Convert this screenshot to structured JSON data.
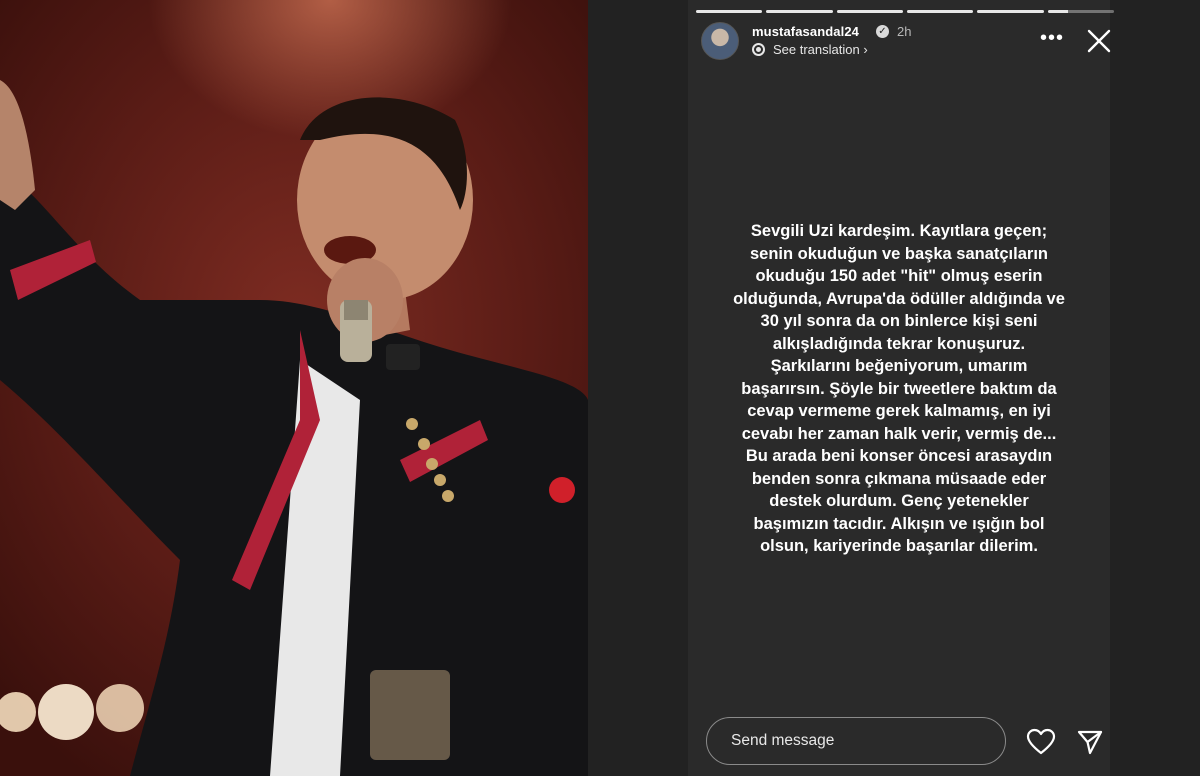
{
  "story": {
    "username": "mustafasandal24",
    "verified_badge": "verified-icon",
    "time_ago": "2h",
    "translate_label": "See translation",
    "translate_chevron": "›",
    "more_label": "•••",
    "progress_segments": 6,
    "progress_completed": 5,
    "progress_current_fill": 0.3,
    "text": "Sevgili Uzi kardeşim. Kayıtlara geçen;\nsenin okuduğun ve başka sanatçıların\nokuduğu 150 adet \"hit\" olmuş eserin\nolduğunda, Avrupa'da ödüller aldığında ve\n30 yıl sonra da on binlerce kişi seni\nalkışladığında tekrar konuşuruz.\nŞarkılarını beğeniyorum, umarım\nbaşarırsın. Şöyle bir tweetlere baktım da\ncevap vermeme gerek kalmamış, en iyi\ncevabı her zaman halk verir, vermiş de...\nBu arada beni konser öncesi arasaydın\nbenden sonra çıkmana müsaade eder\ndestek olurdum. Genç yetenekler\nbaşımızın tacıdır. Alkışın ve ışığın bol\nolsun, kariyerinde başarılar dilerim.",
    "reply_placeholder": "Send message"
  },
  "colors": {
    "panel_bg": "#222222",
    "story_bg": "#2a2a2a",
    "text": "#ffffff",
    "photo_red": "#7e2c22"
  }
}
